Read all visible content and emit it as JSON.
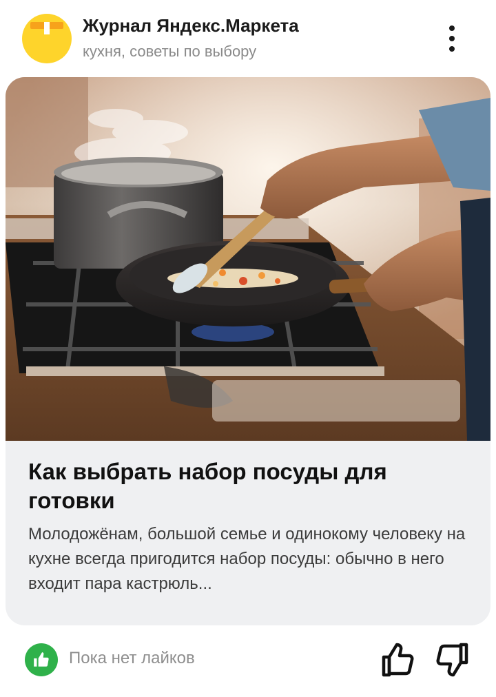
{
  "channel": {
    "name": "Журнал Яндекс.Маркета",
    "tags": "кухня, советы по выбору",
    "avatar_icon": "yandex-market-bag-icon",
    "menu_icon": "more-vertical-icon"
  },
  "article": {
    "title": "Как выбрать набор посуды для готовки",
    "description": "Молодожёнам, большой семье и одинокому человеку на кухне всегда пригодится набор посуды: обычно в него входит пара кастрюль...",
    "image_icon": "cooking-photo"
  },
  "reactions": {
    "likes_text": "Пока нет лайков",
    "likes_icon": "thumbs-up-filled-icon",
    "like_icon": "thumbs-up-icon",
    "dislike_icon": "thumbs-down-icon"
  },
  "colors": {
    "avatar_yellow": "#fed42b",
    "avatar_orange": "#f7a21b",
    "likes_green": "#2fb14a",
    "card_bg": "#eff0f2"
  }
}
